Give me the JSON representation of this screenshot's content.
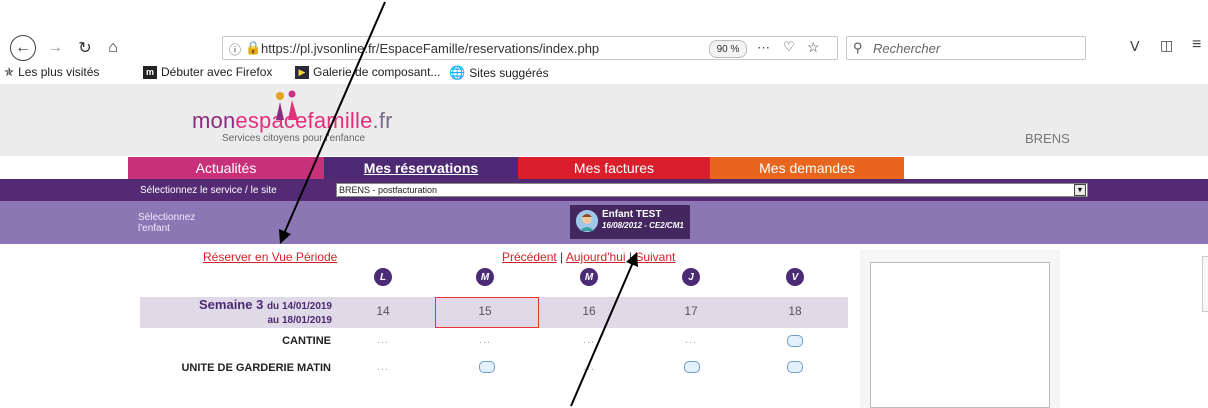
{
  "browser": {
    "url": "https://pl.jvsonline.fr/EspaceFamille/reservations/index.php",
    "zoom": "90 %",
    "search_placeholder": "Rechercher",
    "bookmarks": [
      {
        "label": "Les plus visités",
        "icon": "gear-star-icon"
      },
      {
        "label": "Débuter avec Firefox",
        "icon": "mdn-icon"
      },
      {
        "label": "Galerie de composant...",
        "icon": "gallery-icon"
      },
      {
        "label": "Sites suggérés",
        "icon": "globe-icon"
      }
    ]
  },
  "header": {
    "logo_mon": "mon",
    "logo_famille": "espacefamille",
    "logo_tld": ".fr",
    "tagline": "Services citoyens pour l'enfance",
    "commune": "BRENS"
  },
  "tabs": [
    {
      "label": "Actualités",
      "color": "#c8307a"
    },
    {
      "label": "Mes réservations",
      "color": "#4e2a74"
    },
    {
      "label": "Mes factures",
      "color": "#d91f2b"
    },
    {
      "label": "Mes demandes",
      "color": "#e8651e"
    }
  ],
  "service": {
    "label": "Sélectionnez le service / le site",
    "selected": "BRENS - postfacturation"
  },
  "child": {
    "label": "Sélectionnez l'enfant",
    "name": "Enfant TEST",
    "info": "16/08/2012 - CE2/CM1"
  },
  "schedule": {
    "reserve_link": "Réserver en Vue Période",
    "prev": "Précédent",
    "sep": "|",
    "today": "Aujourd'hui",
    "next": "Suivant",
    "day_letters": [
      "L",
      "M",
      "M",
      "J",
      "V"
    ],
    "week_label": "Semaine 3",
    "week_from": "du 14/01/2019",
    "week_to": "au 18/01/2019",
    "day_numbers": [
      "14",
      "15",
      "16",
      "17",
      "18"
    ],
    "rows": [
      {
        "label": "CANTINE",
        "cells": [
          "...",
          "...",
          "...",
          "...",
          "slot"
        ]
      },
      {
        "label": "UNITE DE GARDERIE MATIN",
        "cells": [
          "...",
          "slot",
          "...",
          "slot",
          "slot"
        ]
      }
    ]
  }
}
